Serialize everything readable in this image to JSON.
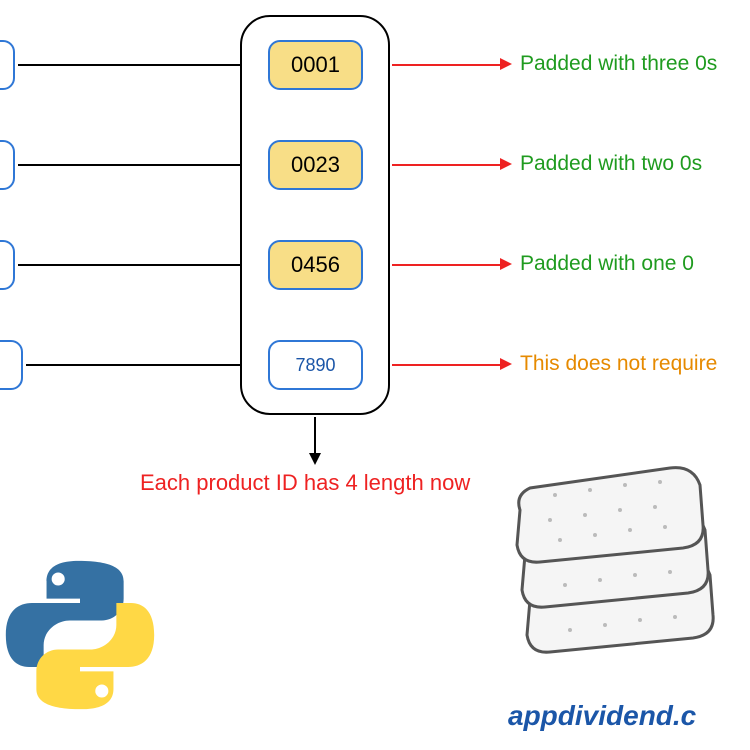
{
  "rows": [
    {
      "input": "",
      "output": "0001",
      "annotation": "Padded with three 0s",
      "padded": true,
      "annot_class": "green"
    },
    {
      "input": "",
      "output": "0023",
      "annotation": "Padded with two 0s",
      "padded": true,
      "annot_class": "green"
    },
    {
      "input": "",
      "output": "0456",
      "annotation": "Padded with one 0",
      "padded": true,
      "annot_class": "green"
    },
    {
      "input": "",
      "output": "7890",
      "annotation": "This does not require ",
      "padded": false,
      "annot_class": "orange"
    }
  ],
  "caption": "Each product ID has 4 length now",
  "brand": "appdividend.c",
  "logos": {
    "python": "python-logo",
    "stack": "stack-logo"
  }
}
